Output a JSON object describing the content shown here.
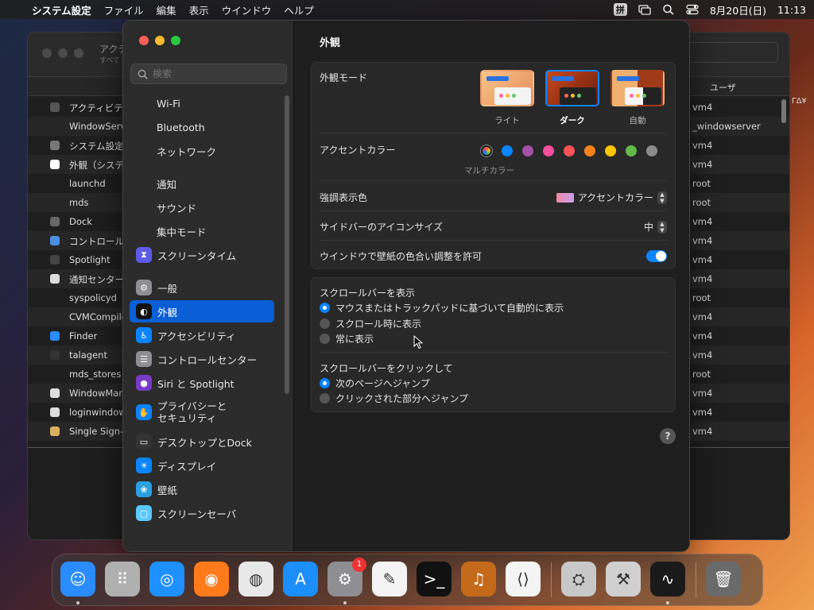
{
  "menubar": {
    "app": "システム設定",
    "items": [
      "ファイル",
      "編集",
      "表示",
      "ウインドウ",
      "ヘルプ"
    ],
    "ime": "拼",
    "date": "8月20日(日)",
    "time": "11:13"
  },
  "background_window": {
    "title": "アクテ",
    "subtitle": "すべて",
    "user_column": "ユーザ",
    "edge_text": "ΓΔ¥",
    "processes": [
      {
        "name": "アクティビティ",
        "user": "vm4",
        "icon_color": "#555"
      },
      {
        "name": "WindowServer",
        "user": "_windowserver",
        "icon_color": ""
      },
      {
        "name": "システム設定",
        "user": "vm4",
        "icon_color": "#777"
      },
      {
        "name": "外観（システム",
        "user": "vm4",
        "icon_color": "#fff"
      },
      {
        "name": "launchd",
        "user": "root",
        "icon_color": ""
      },
      {
        "name": "mds",
        "user": "root",
        "icon_color": ""
      },
      {
        "name": "Dock",
        "user": "vm4",
        "icon_color": "#666"
      },
      {
        "name": "コントロールセ",
        "user": "vm4",
        "icon_color": "#4a90e2"
      },
      {
        "name": "Spotlight",
        "user": "vm4",
        "icon_color": "#444"
      },
      {
        "name": "通知センター",
        "user": "vm4",
        "icon_color": "#ddd"
      },
      {
        "name": "syspolicyd",
        "user": "root",
        "icon_color": ""
      },
      {
        "name": "CVMCompiler",
        "user": "vm4",
        "icon_color": ""
      },
      {
        "name": "Finder",
        "user": "vm4",
        "icon_color": "#2a8cff"
      },
      {
        "name": "talagent",
        "user": "vm4",
        "icon_color": "#333"
      },
      {
        "name": "mds_stores",
        "user": "root",
        "icon_color": ""
      },
      {
        "name": "WindowManager",
        "user": "vm4",
        "icon_color": "#ddd"
      },
      {
        "name": "loginwindow",
        "user": "vm4",
        "icon_color": "#ddd"
      },
      {
        "name": "Single Sign-On",
        "user": "vm4",
        "icon_color": "#d8b060"
      }
    ]
  },
  "sidebar": {
    "search_placeholder": "検索",
    "items": [
      {
        "label": "Wi-Fi",
        "icon": "wifi-icon",
        "color": "",
        "glyph": ""
      },
      {
        "label": "Bluetooth",
        "icon": "bluetooth-icon",
        "color": "",
        "glyph": ""
      },
      {
        "label": "ネットワーク",
        "icon": "network-icon",
        "color": "",
        "glyph": ""
      },
      {
        "label": "通知",
        "icon": "bell-icon",
        "color": "",
        "glyph": ""
      },
      {
        "label": "サウンド",
        "icon": "speaker-icon",
        "color": "",
        "glyph": ""
      },
      {
        "label": "集中モード",
        "icon": "moon-icon",
        "color": "",
        "glyph": ""
      },
      {
        "label": "スクリーンタイム",
        "icon": "hourglass-icon",
        "color": "#5e5ce6",
        "glyph": "⧗"
      },
      {
        "label": "一般",
        "icon": "gear-icon",
        "color": "#8e8e93",
        "glyph": "⚙"
      },
      {
        "label": "外観",
        "icon": "appearance-icon",
        "color": "#111111",
        "glyph": "◐"
      },
      {
        "label": "アクセシビリティ",
        "icon": "accessibility-icon",
        "color": "#0a84ff",
        "glyph": "♿"
      },
      {
        "label": "コントロールセンター",
        "icon": "control-center-icon",
        "color": "#8e8e93",
        "glyph": "☰"
      },
      {
        "label": "Siri と Spotlight",
        "icon": "siri-icon",
        "color": "#7a3cc8",
        "glyph": "●"
      },
      {
        "label": "プライバシーと\nセキュリティ",
        "icon": "hand-icon",
        "color": "#0a84ff",
        "glyph": "✋"
      },
      {
        "label": "デスクトップとDock",
        "icon": "dock-icon",
        "color": "#333333",
        "glyph": "▭"
      },
      {
        "label": "ディスプレイ",
        "icon": "display-icon",
        "color": "#0a84ff",
        "glyph": "☀"
      },
      {
        "label": "壁紙",
        "icon": "wallpaper-icon",
        "color": "#2aa0e0",
        "glyph": "❀"
      },
      {
        "label": "スクリーンセーバ",
        "icon": "screensaver-icon",
        "color": "#5ac8fa",
        "glyph": "▢"
      }
    ]
  },
  "content": {
    "title": "外観",
    "appearance_mode": {
      "label": "外観モード",
      "options": [
        "ライト",
        "ダーク",
        "自動"
      ],
      "selected": "ダーク"
    },
    "accent": {
      "label": "アクセントカラー",
      "caption": "マルチカラー",
      "colors": [
        "multicolor",
        "#0a84ff",
        "#a550a7",
        "#f74f9e",
        "#ff5257",
        "#f7821b",
        "#ffc600",
        "#62ba46",
        "#8c8c8c"
      ]
    },
    "highlight": {
      "label": "強調表示色",
      "value": "アクセントカラー"
    },
    "sidebar_icon_size": {
      "label": "サイドバーのアイコンサイズ",
      "value": "中"
    },
    "wallpaper_tint": {
      "label": "ウインドウで壁紙の色合い調整を許可",
      "enabled": true
    },
    "scrollbars_show": {
      "label": "スクロールバーを表示",
      "options": [
        "マウスまたはトラックパッドに基づいて自動的に表示",
        "スクロール時に表示",
        "常に表示"
      ],
      "selected": 0
    },
    "scrollbar_click": {
      "label": "スクロールバーをクリックして",
      "options": [
        "次のページへジャンプ",
        "クリックされた部分へジャンプ"
      ],
      "selected": 0
    },
    "help": "?"
  },
  "dock": {
    "apps": [
      {
        "name": "finder-icon",
        "color": "#2a8cff",
        "glyph": "☺",
        "running": true
      },
      {
        "name": "launchpad-icon",
        "color": "#b0b0b0",
        "glyph": "⠿",
        "running": false
      },
      {
        "name": "safari-icon",
        "color": "#1e90ff",
        "glyph": "◎",
        "running": false
      },
      {
        "name": "firefox-icon",
        "color": "#ff7a1a",
        "glyph": "◉",
        "running": false
      },
      {
        "name": "chrome-icon",
        "color": "#e8e8e8",
        "glyph": "◍",
        "running": false
      },
      {
        "name": "app-store-icon",
        "color": "#1c8ef9",
        "glyph": "A",
        "running": false
      },
      {
        "name": "system-settings-icon",
        "color": "#8e8e93",
        "glyph": "⚙",
        "running": true,
        "badge": "1"
      },
      {
        "name": "textedit-icon",
        "color": "#f4f4f4",
        "glyph": "✎",
        "running": false
      },
      {
        "name": "terminal-icon",
        "color": "#111111",
        "glyph": ">_",
        "running": false
      },
      {
        "name": "garageband-icon",
        "color": "#c46a1a",
        "glyph": "♫",
        "running": false
      },
      {
        "name": "vscode-icon",
        "color": "#f4f4f4",
        "glyph": "⟨⟩",
        "running": false
      },
      {
        "name": "disk-utility-icon",
        "color": "#c8c8c8",
        "glyph": "⛭",
        "running": false
      },
      {
        "name": "automator-icon",
        "color": "#d0d0d0",
        "glyph": "⚒",
        "running": false
      },
      {
        "name": "activity-monitor-icon",
        "color": "#1a1a1a",
        "glyph": "∿",
        "running": true
      },
      {
        "name": "trash-icon",
        "color": "#6a6a6a",
        "glyph": "🗑",
        "running": false
      }
    ]
  }
}
